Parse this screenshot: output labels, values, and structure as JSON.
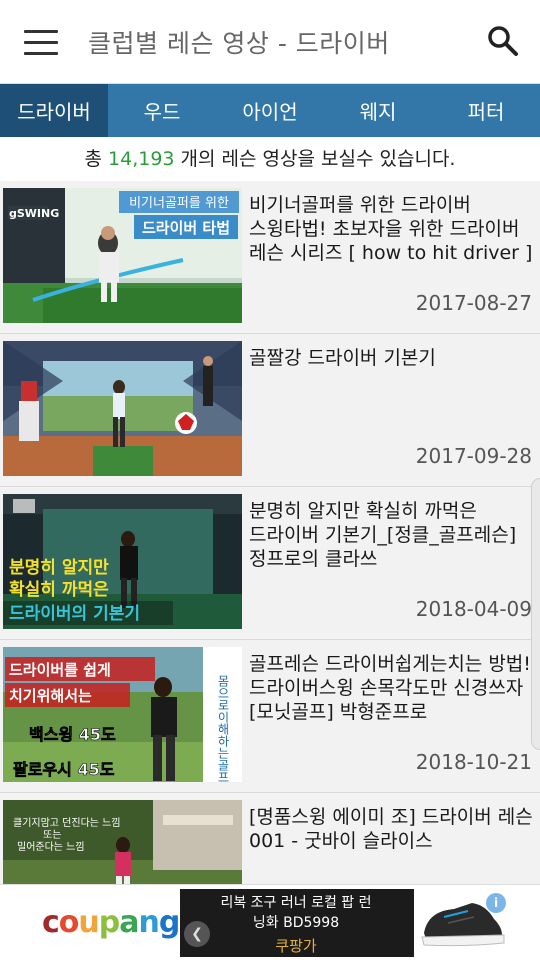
{
  "header": {
    "title": "클럽별 레슨 영상 - 드라이버",
    "menu_icon": "hamburger-menu-icon",
    "search_icon": "search-icon"
  },
  "tabs": [
    {
      "label": "드라이버",
      "active": true
    },
    {
      "label": "우드",
      "active": false
    },
    {
      "label": "아이언",
      "active": false
    },
    {
      "label": "웨지",
      "active": false
    },
    {
      "label": "퍼터",
      "active": false
    }
  ],
  "summary": {
    "prefix": "총 ",
    "count": "14,193",
    "suffix": " 개의 레슨 영상을 보실수 있습니다."
  },
  "videos": [
    {
      "title": "비기너골퍼를 위한 드라이버 스윙타법! 초보자을 위한 드라이버 레슨 시리즈 [ how to hit driver ]",
      "date": "2017-08-27",
      "thumb_text1": "비기너골퍼를 위한",
      "thumb_text2": "드라이버 타법",
      "thumb_logo": "gSWING"
    },
    {
      "title": "골짤강 드라이버 기본기",
      "date": "2017-09-28"
    },
    {
      "title": "분명히 알지만 확실히 까먹은 드라이버 기본기_[정클_골프레슨]정프로의 클라쓰",
      "date": "2018-04-09",
      "thumb_text1": "분명히 알지만",
      "thumb_text2": "확실히 까먹은",
      "thumb_text3": "드라이버의 기본기"
    },
    {
      "title": "골프레슨 드라이버쉽게는치는 방법! 드라이버스윙 손목각도만 신경쓰자 [모닛골프] 박형준프로",
      "date": "2018-10-21",
      "thumb_text1": "드라이버를 쉽게",
      "thumb_text2": "치기위해서는",
      "thumb_text3": "백스윙 45도",
      "thumb_text4": "팔로우시 45도",
      "thumb_side": "몸으로이해하는골프"
    },
    {
      "title": "[명품스윙 에이미 조] 드라이버 레슨 001 - 굿바이 슬라이스",
      "date": "",
      "thumb_text1": "클기지맘고 던진다는 느낌",
      "thumb_text2": "또는",
      "thumb_text3": "밀어준다는 느낌"
    }
  ],
  "ad": {
    "brand": "coupang",
    "line1": "리복 조구 러너 로컬 팝 런",
    "line2": "닝화 BD5998",
    "seller": "쿠팡가",
    "info_icon": "info-icon",
    "prev_icon": "chevron-left-icon",
    "colors": {
      "c": "#a02a2a",
      "o": "#e64a2e",
      "u": "#f2a33a",
      "p": "#8cbf3f",
      "a": "#3aa655",
      "n": "#2e9ad6",
      "g": "#1b74c5"
    }
  },
  "colors": {
    "tab_bar": "#3277a8",
    "tab_active": "#1d4f77",
    "count_green": "#2c9c3a"
  }
}
